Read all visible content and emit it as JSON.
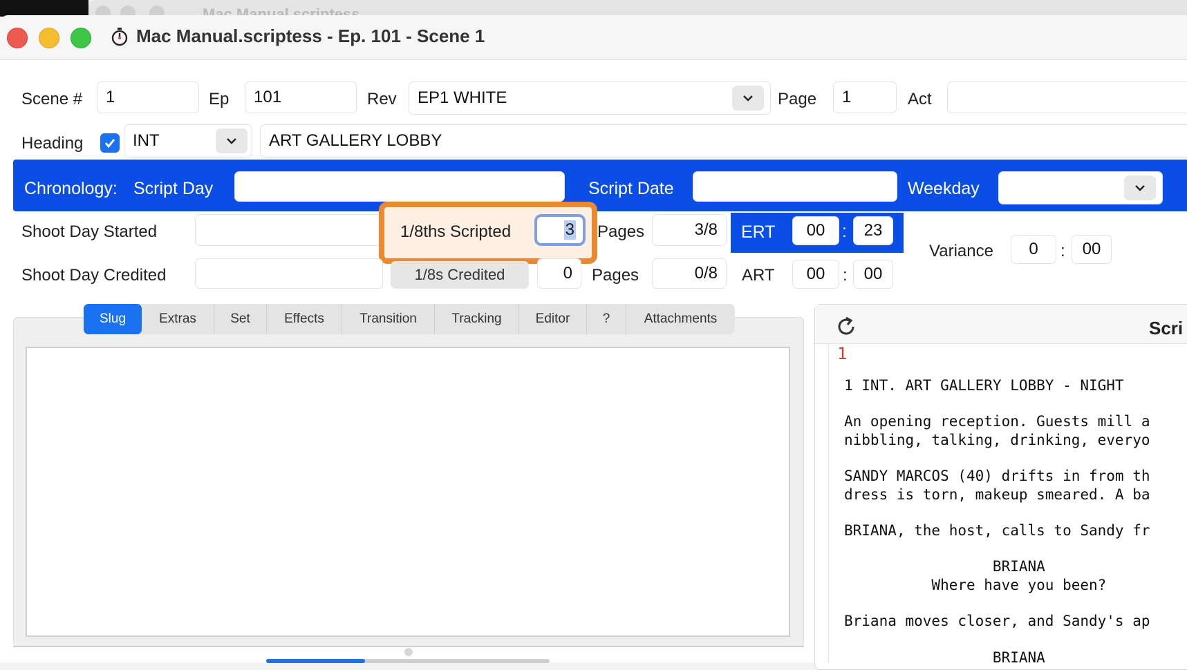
{
  "background_window": {
    "title": "Mac Manual.scriptess"
  },
  "window": {
    "title": "Mac Manual.scriptess - Ep. 101 - Scene 1"
  },
  "form": {
    "scene_label": "Scene #",
    "scene_value": "1",
    "ep_label": "Ep",
    "ep_value": "101",
    "rev_label": "Rev",
    "rev_value": "EP1 WHITE",
    "page_label": "Page",
    "page_value": "1",
    "act_label": "Act",
    "act_value": "",
    "heading_label": "Heading",
    "heading_checked": true,
    "int_ext_value": "INT",
    "location_value": "ART GALLERY LOBBY"
  },
  "chronology": {
    "label": "Chronology:",
    "script_day_label": "Script Day",
    "script_day_value": "",
    "script_date_label": "Script Date",
    "script_date_value": "",
    "weekday_label": "Weekday",
    "weekday_value": ""
  },
  "timing": {
    "shoot_started_label": "Shoot Day Started",
    "shoot_started_value": "",
    "shoot_credited_label": "Shoot Day Credited",
    "shoot_credited_value": "",
    "scripted_label": "1/8ths Scripted",
    "scripted_value": "3",
    "credited_button": "1/8s Credited",
    "credited_value": "0",
    "pages_label": "Pages",
    "pages_scripted": "3/8",
    "pages_credited": "0/8",
    "ert_label": "ERT",
    "ert_min": "00",
    "ert_sec": "23",
    "art_label": "ART",
    "art_min": "00",
    "art_sec": "00",
    "variance_label": "Variance",
    "variance_min": "0",
    "variance_sec": "00",
    "colon": ":"
  },
  "tabs": [
    "Slug",
    "Extras",
    "Set",
    "Effects",
    "Transition",
    "Tracking",
    "Editor",
    "?",
    "Attachments"
  ],
  "active_tab": "Slug",
  "script_panel": {
    "title": "Scri",
    "page_number": "1",
    "lines": [
      "1 INT. ART GALLERY LOBBY - NIGHT",
      "",
      "An opening reception. Guests mill a",
      "nibbling, talking, drinking, everyo",
      "",
      "SANDY MARCOS (40) drifts in from th",
      "dress is torn, makeup smeared. A ba",
      "",
      "BRIANA, the host, calls to Sandy fr",
      "",
      "                 BRIANA",
      "          Where have you been?",
      "",
      "Briana moves closer, and Sandy's ap",
      "",
      "                 BRIANA"
    ]
  },
  "colors": {
    "accent_blue": "#0a4ee6",
    "tab_active": "#1b72f0",
    "highlight_orange": "#e98a32",
    "page_number_red": "#d23b2f"
  }
}
